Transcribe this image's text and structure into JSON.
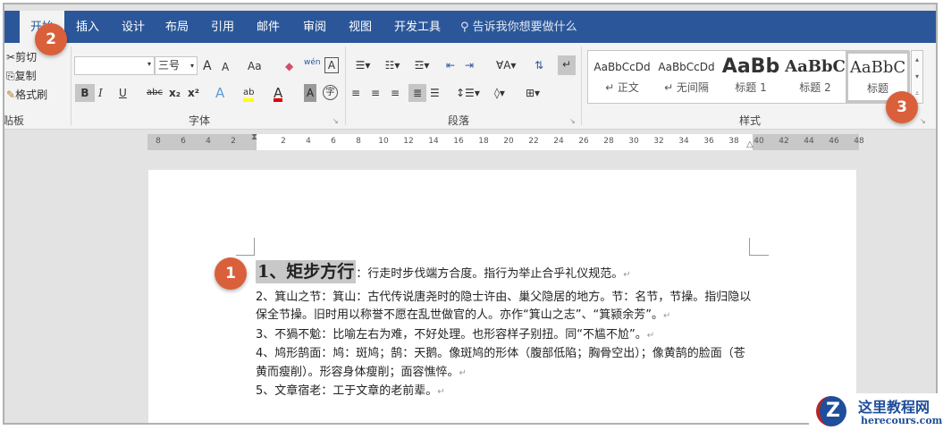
{
  "tabs": [
    "开始",
    "插入",
    "设计",
    "布局",
    "引用",
    "邮件",
    "审阅",
    "视图",
    "开发工具"
  ],
  "tell_me": "告诉我你想要做什么",
  "clipboard": {
    "cut": "剪切",
    "copy": "复制",
    "format_painter": "格式刷",
    "label": "剪贴板"
  },
  "font": {
    "name": "",
    "size": "三号",
    "label": "字体",
    "change_case": "Aa",
    "grow": "A",
    "shrink": "A",
    "bold": "B",
    "italic": "I",
    "underline": "U",
    "strike": "abc",
    "sub": "x₂",
    "sup": "x²",
    "phonetic": "wén",
    "char_border": "A",
    "text_effect": "A",
    "highlight": "ab",
    "font_color": "A",
    "char_shading": "A",
    "enclose": "字",
    "highlight_color": "#ffff00",
    "font_color_value": "#e00000"
  },
  "paragraph": {
    "label": "段落"
  },
  "styles": {
    "label": "样式",
    "items": [
      {
        "sample": "AaBbCcDd",
        "name": "↵ 正文"
      },
      {
        "sample": "AaBbCcDd",
        "name": "↵ 无间隔"
      },
      {
        "sample": "AaBb",
        "name": "标题 1"
      },
      {
        "sample": "AaBbC",
        "name": "标题 2"
      },
      {
        "sample": "AaBbC",
        "name": "标题"
      }
    ]
  },
  "ruler": {
    "left": [
      "8",
      "6",
      "4",
      "2"
    ],
    "right": [
      "2",
      "4",
      "6",
      "8",
      "10",
      "12",
      "14",
      "16",
      "18",
      "20",
      "22",
      "24",
      "26",
      "28",
      "30",
      "32",
      "34",
      "36",
      "38",
      "40",
      "42",
      "44",
      "46",
      "48"
    ]
  },
  "document": {
    "heading": "1、矩步方行",
    "heading_rest": "：行走时步伐端方合度。指行为举止合乎礼仪规范。",
    "paragraphs": [
      "2、箕山之节：箕山：古代传说唐尧时的隐士许由、巢父隐居的地方。节：名节，节操。指归隐以保全节操。旧时用以称誉不愿在乱世做官的人。亦作“箕山之志”、“箕颍余芳”。",
      "3、不猧不魀：比喻左右为难，不好处理。也形容样子别扭。同“不尴不尬”。",
      "4、鸠形鹄面：鸠：斑鸠；鹄：天鹅。像斑鸠的形体（腹部低陷；胸骨空出）；像黄鹄的脸面（苍黄而瘦削）。形容身体瘦削；面容憔悴。",
      "5、文章宿老：工于文章的老前辈。"
    ],
    "para_mark": "↵"
  },
  "badges": [
    "1",
    "2",
    "3"
  ],
  "watermark": {
    "title": "这里教程网",
    "url": "herecours.com"
  },
  "colors": {
    "tabbar": "#2b579a",
    "badge": "#d9603b"
  }
}
